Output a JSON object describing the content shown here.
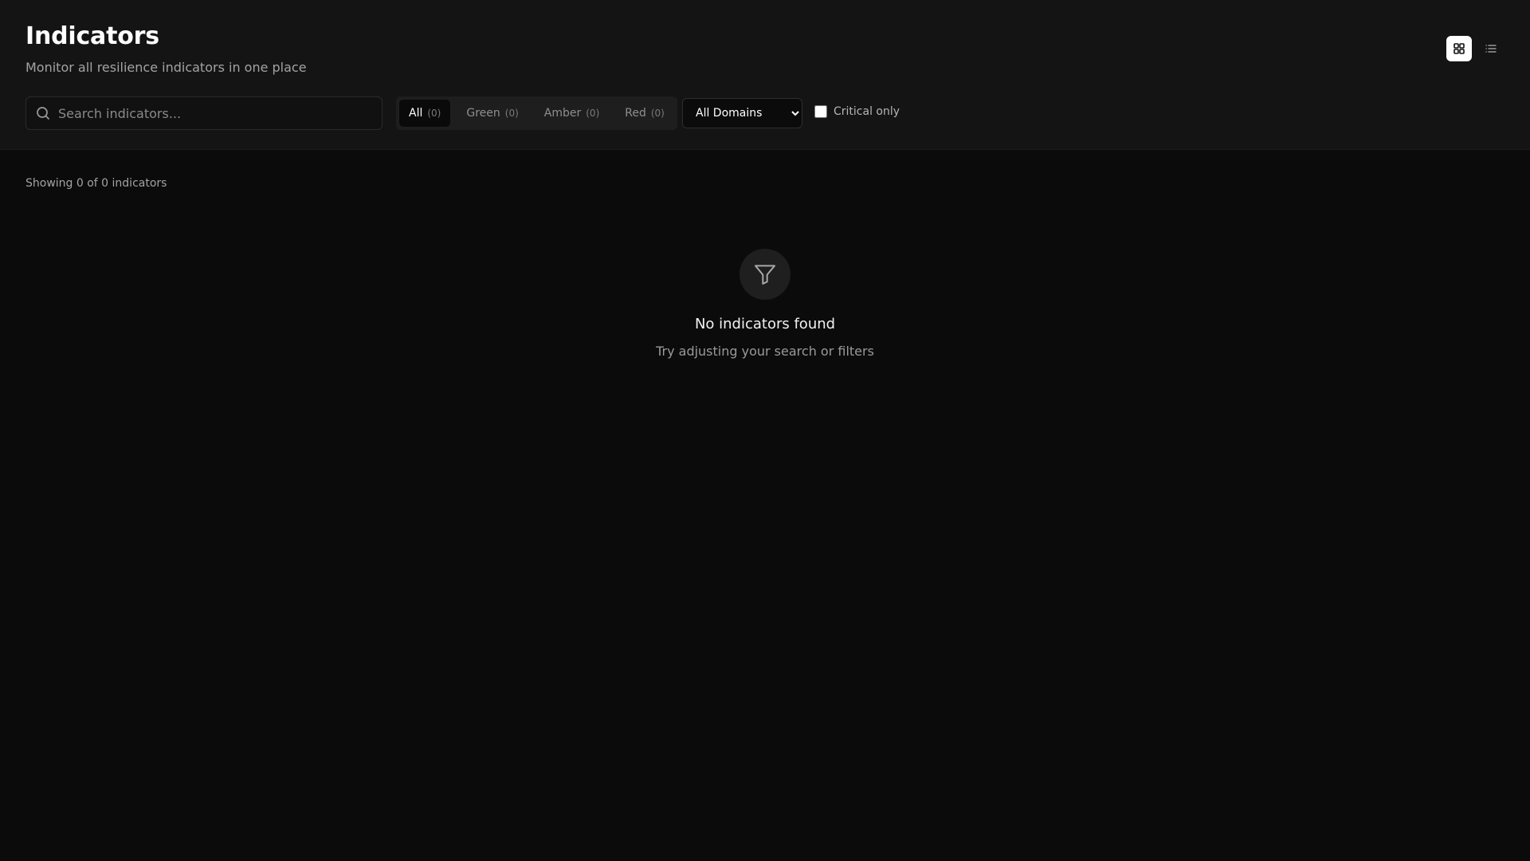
{
  "header": {
    "title": "Indicators",
    "subtitle": "Monitor all resilience indicators in one place"
  },
  "view_toggle": {
    "grid_icon": "grid-icon",
    "list_icon": "list-icon",
    "active": "grid"
  },
  "search": {
    "placeholder": "Search indicators...",
    "value": "",
    "icon": "search-icon"
  },
  "status_tabs": [
    {
      "label": "All",
      "count": "(0)",
      "active": true
    },
    {
      "label": "Green",
      "count": "(0)",
      "active": false
    },
    {
      "label": "Amber",
      "count": "(0)",
      "active": false
    },
    {
      "label": "Red",
      "count": "(0)",
      "active": false
    }
  ],
  "domain_filter": {
    "selected": "All Domains"
  },
  "critical_filter": {
    "label": "Critical only",
    "checked": false
  },
  "results": {
    "summary": "Showing 0 of 0 indicators"
  },
  "empty_state": {
    "icon": "filter-icon",
    "title": "No indicators found",
    "hint": "Try adjusting your search or filters"
  },
  "colors": {
    "background": "#0b0b0b",
    "header_background": "#141414",
    "text_primary": "#ffffff",
    "text_muted": "#a3a3a3"
  }
}
